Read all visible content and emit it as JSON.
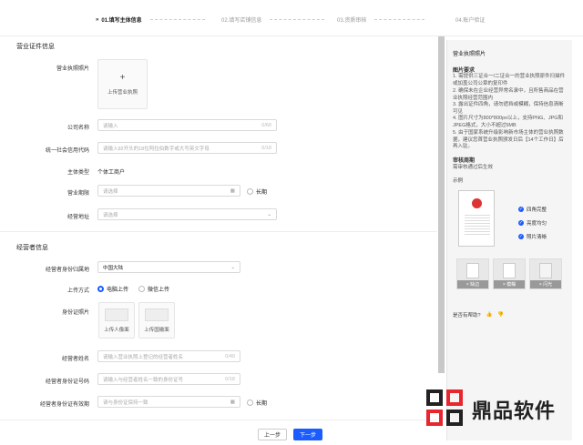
{
  "steps": [
    {
      "label": "01.填写主体信息",
      "active": true
    },
    {
      "label": "02.填写店铺信息",
      "active": false
    },
    {
      "label": "03.资质审核",
      "active": false
    },
    {
      "label": "04.账户验证",
      "active": false
    }
  ],
  "license_section": {
    "title": "营业证件信息",
    "license_photo_label": "营业执照照片",
    "upload_license_text": "上传营业执照",
    "company_name_label": "公司名称",
    "company_name_placeholder": "请输入",
    "company_name_count": "0/60",
    "credit_code_label": "统一社会信用代码",
    "credit_code_placeholder": "请输入92开头的18位阿拉伯数字或大写英文字母",
    "credit_code_count": "0/18",
    "entity_type_label": "主体类型",
    "entity_type_value": "个体工商户",
    "business_term_label": "营业期限",
    "business_term_placeholder": "请选择",
    "long_term_label": "长期",
    "business_address_label": "经营地址",
    "business_address_placeholder": "请选择"
  },
  "operator_section": {
    "title": "经营者信息",
    "id_region_label": "经营者身份归属地",
    "id_region_value": "中国大陆",
    "upload_method_label": "上传方式",
    "upload_computer": "电脑上传",
    "upload_wechat": "微信上传",
    "id_photo_label": "身份证照片",
    "upload_portrait": "上传人像面",
    "upload_emblem": "上传国徽面",
    "name_label": "经营者姓名",
    "name_placeholder": "请输入营业执照上登记的经营者姓名",
    "name_count": "0/40",
    "id_number_label": "经营者身份证号码",
    "id_number_placeholder": "请输入与经营者姓名一致的身份证号",
    "id_number_count": "0/18",
    "id_validity_label": "经营者身份证有效期",
    "id_validity_placeholder": "请与身份证保持一致",
    "long_term_label": "长期"
  },
  "footer": {
    "prev": "上一步",
    "next": "下一步"
  },
  "panel": {
    "title": "营业执照照片",
    "req_title": "图片要求",
    "requirements": [
      "1. 需提供三证合一/二证合一的营业执照原件扫描件或加盖公司公章的复印件",
      "2. 确保未在企业经营异常名录中，且所售商品在营业执照经营范围内",
      "3. 露出证件四角，请勿遮挡或模糊，保持信息清晰可见",
      "4. 图片尺寸为800*800px以上，支持PNG、JPG和JPEG格式，大小不超过5MB",
      "5. 由于国家系统升级影响新市场主体的营业执照数据，建议您首营业执照颁发日后【14个工作日】后再入驻。"
    ],
    "seal_title": "审核周期",
    "seal_text": "需审核通过后生效",
    "example_label": "示例",
    "checks": [
      "四角完整",
      "亮度均匀",
      "照片清晰"
    ],
    "thumb_tags": [
      "× 缺边",
      "× 模糊",
      "× 闪光"
    ],
    "helpful": "是否有帮助?"
  },
  "brand": {
    "text": "鼎品软件",
    "color": "#e8262d"
  },
  "colors": {
    "accent": "#1a5cff"
  }
}
